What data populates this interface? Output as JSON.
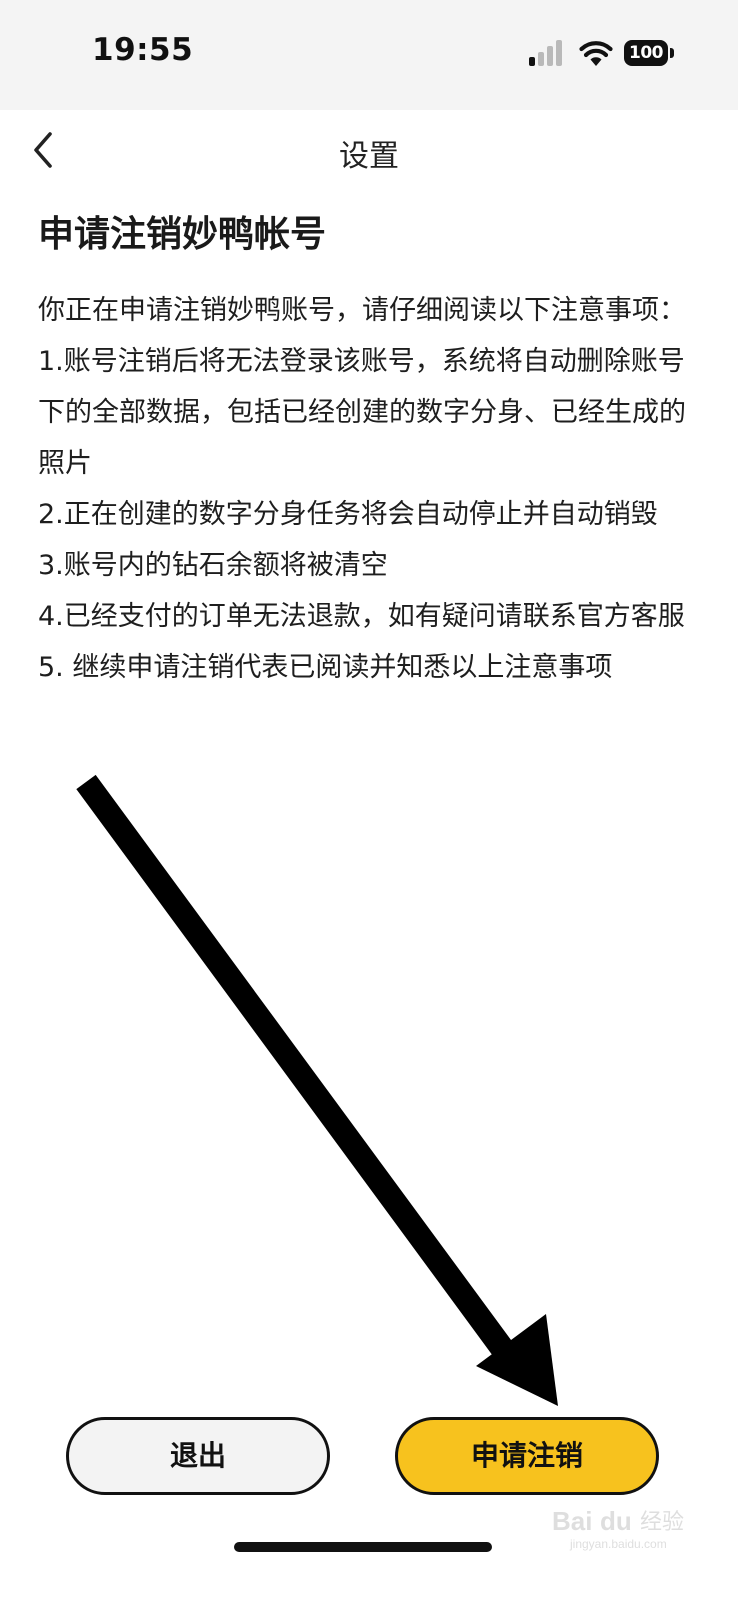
{
  "status_bar": {
    "time": "19:55",
    "battery": "100",
    "icons": [
      "signal-icon",
      "wifi-icon",
      "battery-icon"
    ]
  },
  "nav": {
    "title": "设置",
    "back_icon": "chevron-left-icon"
  },
  "content": {
    "heading": "申请注销妙鸭帐号",
    "intro": "你正在申请注销妙鸭账号，请仔细阅读以下注意事项：",
    "items": [
      "1.账号注销后将无法登录该账号，系统将自动删除账号下的全部数据，包括已经创建的数字分身、已经生成的照片",
      "2.正在创建的数字分身任务将会自动停止并自动销毁",
      "3.账号内的钻石余额将被清空",
      "4.已经支付的订单无法退款，如有疑问请联系官方客服",
      "5. 继续申请注销代表已阅读并知悉以上注意事项"
    ]
  },
  "buttons": {
    "exit_label": "退出",
    "apply_cancel_label": "申请注销",
    "accent_color": "#f7c21e"
  },
  "annotation": {
    "arrow_icon": "pointer-arrow-icon",
    "arrow_color": "#000000"
  },
  "watermark": {
    "line1": "Bai du 经验",
    "line2": "jingyan.baidu.com"
  }
}
